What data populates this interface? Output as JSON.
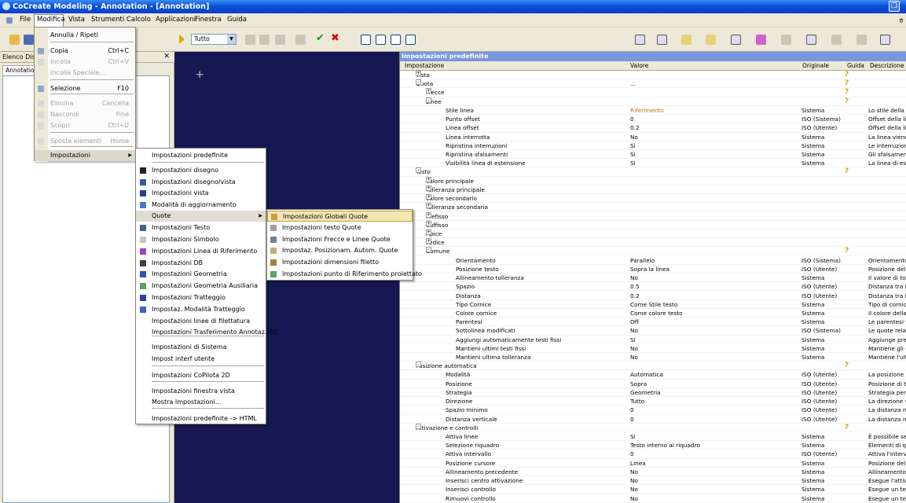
{
  "window": {
    "title": "CoCreate Modeling - Annotation - [Annotation]",
    "restore_glyph": "❐"
  },
  "menubar": {
    "items": [
      "File",
      "Modifica",
      "Vista",
      "Strumenti",
      "Calcolo",
      "Applicazioni",
      "Finestra",
      "Guida"
    ],
    "right_glyph": "ㅎ"
  },
  "toolbar": {
    "filter_value": "Tutto"
  },
  "left_panel": {
    "title": "Elenco Dise",
    "tab": "Annotation",
    "close_glyph": "✕"
  },
  "canvas": {
    "cursor_glyph": "+"
  },
  "edit_menu": {
    "items": [
      {
        "label": "Annulla / Ripeti",
        "shortcut": "",
        "enabled": true
      },
      {
        "label": "Copia",
        "shortcut": "Ctrl+C",
        "enabled": true
      },
      {
        "label": "Incolla",
        "shortcut": "Ctrl+V",
        "enabled": false
      },
      {
        "label": "Incolla Speciale...",
        "shortcut": "",
        "enabled": false
      },
      {
        "label": "Selezione",
        "shortcut": "F10",
        "enabled": true
      },
      {
        "label": "Elimina",
        "shortcut": "Cancella",
        "enabled": false
      },
      {
        "label": "Nascondi",
        "shortcut": "Fine",
        "enabled": false
      },
      {
        "label": "Scopri",
        "shortcut": "Ctrl+U",
        "enabled": false
      },
      {
        "label": "Sposta elementi",
        "shortcut": "Home",
        "enabled": false
      },
      {
        "label": "Impostazioni",
        "shortcut": "",
        "enabled": true
      }
    ]
  },
  "settings_menu": {
    "items": [
      "Impostazioni predefinite",
      "Impostazioni disegno",
      "Impostazioni disegno/vista",
      "Impostazioni vista",
      "Modalità di aggiornamento",
      "Quote",
      "Impostazioni Testo",
      "Impostazioni Simbolo",
      "Impostazioni Linea di Riferimento",
      "Impostazioni DB",
      "Impostazioni Geometria",
      "Impostazioni Geometria Ausiliaria",
      "Impostazioni Tratteggio",
      "Impostaz. Modalità Tratteggio",
      "Impostazioni linee di filettatura",
      "Impostazioni Trasferimento Annotaz. 3D",
      "Impostazioni di Sistema",
      "Impost interf utente",
      "Impostazioni CoPilota 2D",
      "Impostazioni finestra vista",
      "Mostra Impostazioni...",
      "Impostazioni predefinite -> HTML"
    ]
  },
  "quote_menu": {
    "items": [
      "Impostazioni Globali Quote",
      "Impostazioni testo Quote",
      "Impostazioni Frecce e Linee Quote",
      "Impostaz. Posizionam. Autom. Quote",
      "Impostazioni dimensioni filetto",
      "Impostazioni punto di Riferimento proiettato"
    ]
  },
  "settings_panel": {
    "title": "Impostazioni predefinite",
    "columns": [
      "Impostazione",
      "Valore",
      "Originale",
      "Guida",
      "Descrizione"
    ],
    "rows": [
      {
        "n": "Vista",
        "v": "",
        "o": "",
        "d": "",
        "lvl": 1,
        "exp": "+",
        "h": true
      },
      {
        "n": "Quota",
        "v": "...",
        "o": "",
        "d": "",
        "lvl": 1,
        "exp": "-",
        "h": true
      },
      {
        "n": "Frecce",
        "v": "",
        "o": "",
        "d": "",
        "lvl": 2,
        "exp": "+",
        "h": true
      },
      {
        "n": "Linee",
        "v": "",
        "o": "",
        "d": "",
        "lvl": 2,
        "exp": "-",
        "h": true
      },
      {
        "n": "Stile linea",
        "v": "Riferimento",
        "o": "Sistema",
        "d": "Lo stile della lin",
        "lvl": 3,
        "accent": true
      },
      {
        "n": "Punto offset",
        "v": "0",
        "o": "ISO (Sistema)",
        "d": "Offset della lin",
        "lvl": 3
      },
      {
        "n": "Linea offset",
        "v": "0.2",
        "o": "ISO (Utente)",
        "d": "Offset della lin",
        "lvl": 3
      },
      {
        "n": "Linea interrotta",
        "v": "No",
        "o": "Sistema",
        "d": "La linea viene",
        "lvl": 3
      },
      {
        "n": "Ripristina interruzioni",
        "v": "Sì",
        "o": "Sistema",
        "d": "Le interruzioni",
        "lvl": 3
      },
      {
        "n": "Ripristina sfalsamenti",
        "v": "Sì",
        "o": "Sistema",
        "d": "Gli sfalsamenti",
        "lvl": 3
      },
      {
        "n": "Visibilità linea di estensione",
        "v": "Sì",
        "o": "Sistema",
        "d": "La linea di este",
        "lvl": 3
      },
      {
        "n": "Testo",
        "v": "",
        "o": "",
        "d": "",
        "lvl": 1,
        "exp": "-",
        "h": true
      },
      {
        "n": "Valore principale",
        "v": "",
        "o": "",
        "d": "",
        "lvl": 2,
        "exp": "+"
      },
      {
        "n": "Tolleranza principale",
        "v": "",
        "o": "",
        "d": "",
        "lvl": 2,
        "exp": "+"
      },
      {
        "n": "Valore secondario",
        "v": "",
        "o": "",
        "d": "",
        "lvl": 2,
        "exp": "+"
      },
      {
        "n": "Tolleranza secondaria",
        "v": "",
        "o": "",
        "d": "",
        "lvl": 2,
        "exp": "+"
      },
      {
        "n": "Prefisso",
        "v": "",
        "o": "",
        "d": "",
        "lvl": 2,
        "exp": "+"
      },
      {
        "n": "Suffisso",
        "v": "",
        "o": "",
        "d": "",
        "lvl": 2,
        "exp": "+"
      },
      {
        "n": "Apice",
        "v": "",
        "o": "",
        "d": "",
        "lvl": 2,
        "exp": "+"
      },
      {
        "n": "Pedice",
        "v": "",
        "o": "",
        "d": "",
        "lvl": 2,
        "exp": "+"
      },
      {
        "n": "Comune",
        "v": "",
        "o": "",
        "d": "",
        "lvl": 2,
        "exp": "-",
        "h": true
      },
      {
        "n": "Orientamento",
        "v": "Parallelo",
        "o": "ISO (Sistema)",
        "d": "Orientamento",
        "lvl": 4
      },
      {
        "n": "Posizione testo",
        "v": "Sopra la linea",
        "o": "ISO (Utente)",
        "d": "Posizione del t",
        "lvl": 4
      },
      {
        "n": "Allineamento tolleranza",
        "v": "No",
        "o": "Sistema",
        "d": "Il valore di toll",
        "lvl": 4
      },
      {
        "n": "Spazio",
        "v": "0.5",
        "o": "ISO (Utente)",
        "d": "Distanza tra il",
        "lvl": 4
      },
      {
        "n": "Distanza",
        "v": "0.2",
        "o": "ISO (Utente)",
        "d": "Distanza tra il",
        "lvl": 4
      },
      {
        "n": "Tipo Cornice",
        "v": "Come Stile testo",
        "o": "Sistema",
        "d": "Tipo di cornice",
        "lvl": 4
      },
      {
        "n": "Colore cornice",
        "v": "Come colore testo",
        "o": "Sistema",
        "d": "Il colore della c",
        "lvl": 4
      },
      {
        "n": "Parentesi",
        "v": "Off",
        "o": "Sistema",
        "d": "Le parentesi v",
        "lvl": 4
      },
      {
        "n": "Sottolinea modificati",
        "v": "No",
        "o": "ISO (Sistema)",
        "d": "Le quote relati",
        "lvl": 4
      },
      {
        "n": "Aggiungi automaticamente testi fissi",
        "v": "Sì",
        "o": "Sistema",
        "d": "Aggiunge pref",
        "lvl": 4
      },
      {
        "n": "Mantieni ultimi testi fissi",
        "v": "No",
        "o": "Sistema",
        "d": "Mantiene gli ul",
        "lvl": 4
      },
      {
        "n": "Mantieni ultima tolleranza",
        "v": "No",
        "o": "Sistema",
        "d": "Mantiene l'ultim",
        "lvl": 4
      },
      {
        "n": "Posizione automatica",
        "v": "",
        "o": "",
        "d": "",
        "lvl": 1,
        "exp": "-",
        "h": true
      },
      {
        "n": "Modalità",
        "v": "Automatica",
        "o": "ISO (Utente)",
        "d": "La posizione a",
        "lvl": 3
      },
      {
        "n": "Posizione",
        "v": "Sopra",
        "o": "ISO (Utente)",
        "d": "Posizione di te",
        "lvl": 3
      },
      {
        "n": "Strategia",
        "v": "Geometria",
        "o": "ISO (Utente)",
        "d": "Strategia per l",
        "lvl": 3
      },
      {
        "n": "Direzione",
        "v": "Tutto",
        "o": "ISO (Utente)",
        "d": "La direzione vi",
        "lvl": 3
      },
      {
        "n": "Spazio minimo",
        "v": "0",
        "o": "ISO (Utente)",
        "d": "La distanza mi",
        "lvl": 3
      },
      {
        "n": "Distanza verticale",
        "v": "0",
        "o": "ISO (Utente)",
        "d": "La distanza minim",
        "lvl": 3
      },
      {
        "n": "Attivazione e controlli",
        "v": "",
        "o": "",
        "d": "",
        "lvl": 1,
        "exp": "-",
        "h": true
      },
      {
        "n": "Attiva linee",
        "v": "Sì",
        "o": "Sistema",
        "d": "È possibile sele",
        "lvl": 3
      },
      {
        "n": "Selezione riquadro",
        "v": "Testo interno al riquadro",
        "o": "Sistema",
        "d": "Elementi di qu",
        "lvl": 3
      },
      {
        "n": "Attiva intervallo",
        "v": "0",
        "o": "ISO (Utente)",
        "d": "Attiva l'interva",
        "lvl": 3
      },
      {
        "n": "Posizione cursore",
        "v": "Linea",
        "o": "Sistema",
        "d": "Posizione del c",
        "lvl": 3
      },
      {
        "n": "Allineamento precedente",
        "v": "No",
        "o": "Sistema",
        "d": "Allineamento c",
        "lvl": 3
      },
      {
        "n": "Inserisci centro attivazione",
        "v": "No",
        "o": "Sistema",
        "d": "Esegue l'attiva",
        "lvl": 3
      },
      {
        "n": "Inserisci controllo",
        "v": "No",
        "o": "Sistema",
        "d": "Esegue un tes",
        "lvl": 3
      },
      {
        "n": "Rimuovi controllo",
        "v": "No",
        "o": "Sistema",
        "d": "Esegue un tes",
        "lvl": 3
      }
    ]
  },
  "colors": {
    "accent": "#c07000",
    "help": "#c9a800",
    "canvas": "#151852",
    "selection": "#316ac5"
  },
  "glyphs": {
    "help": "?",
    "submenu_arrow": "▶",
    "dropdown": "▼"
  }
}
